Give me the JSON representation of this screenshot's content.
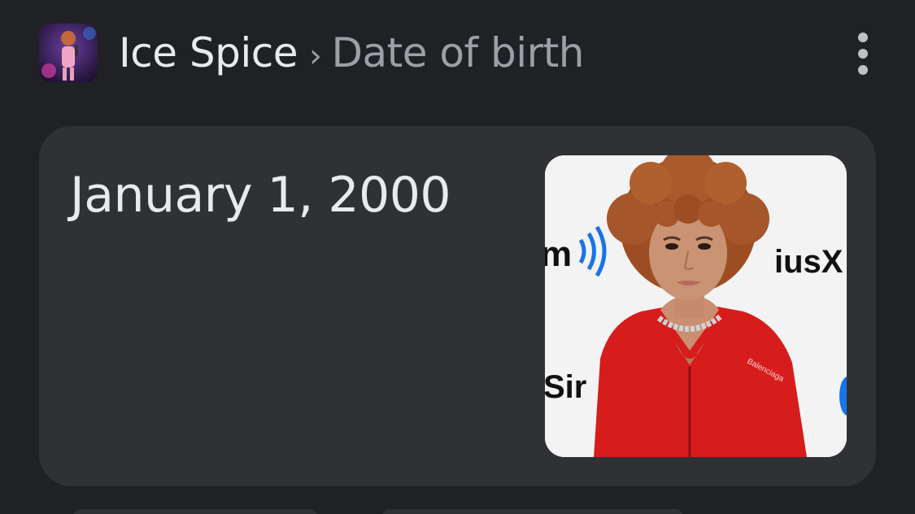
{
  "header": {
    "entity": "Ice Spice",
    "separator": "›",
    "attribute": "Date of birth",
    "more_icon": "more-vert-icon"
  },
  "answer": {
    "value": "January 1, 2000"
  },
  "photo": {
    "backdrop_text_left": "m",
    "backdrop_text_right": "iusX",
    "backdrop_text_bottom": "Sir",
    "shirt_logo": "Balenciaga"
  },
  "colors": {
    "background": "#202124",
    "card": "#303134",
    "primary_text": "#e8eaed",
    "secondary_text": "#9aa0a6",
    "accent_blue": "#1a73e8",
    "shirt_red": "#d71c1c",
    "hair": "#a0522d"
  }
}
